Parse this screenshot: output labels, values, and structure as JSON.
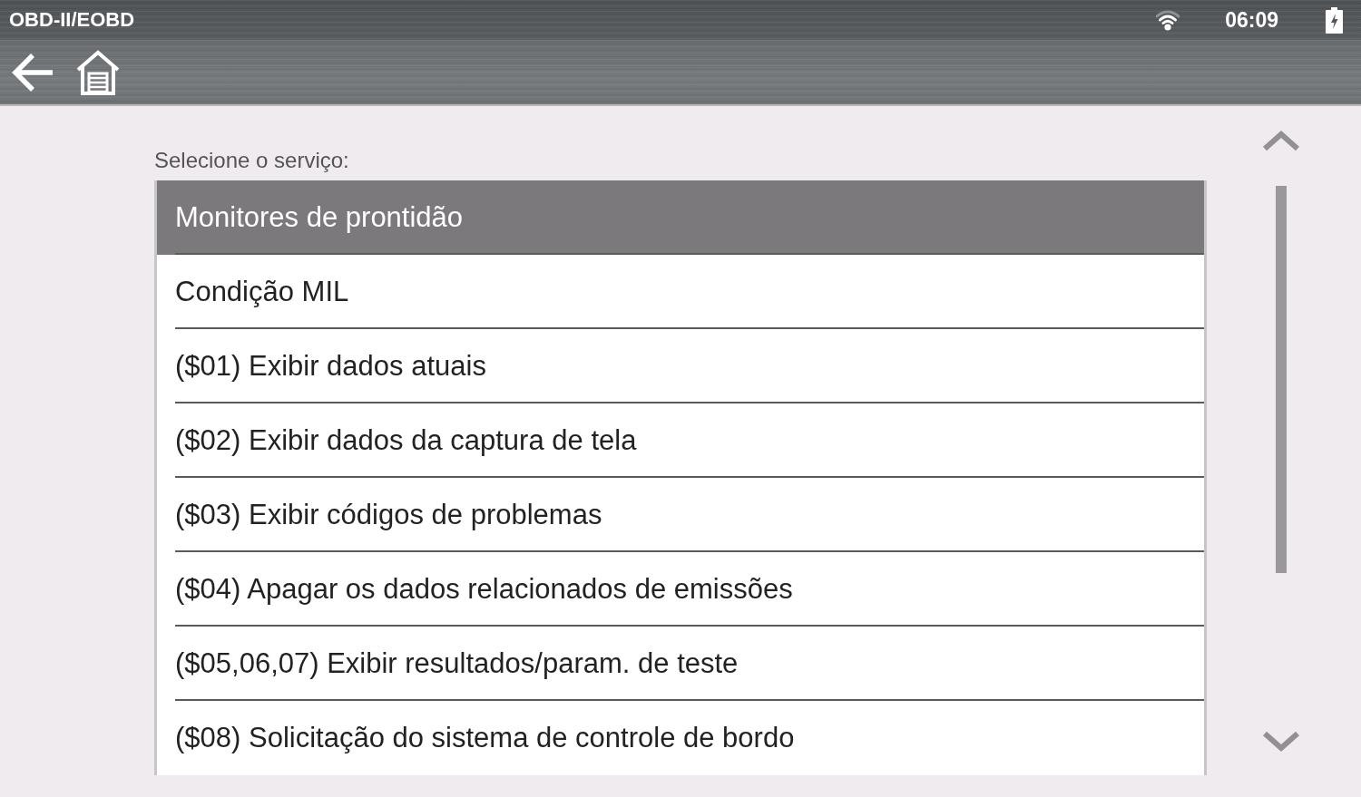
{
  "status_bar": {
    "title": "OBD-II/EOBD",
    "time": "06:09"
  },
  "prompt": "Selecione o serviço:",
  "services": [
    {
      "label": "Monitores de prontidão",
      "selected": true
    },
    {
      "label": "Condição MIL",
      "selected": false
    },
    {
      "label": "($01) Exibir dados atuais",
      "selected": false
    },
    {
      "label": "($02) Exibir dados da captura de tela",
      "selected": false
    },
    {
      "label": "($03) Exibir códigos de problemas",
      "selected": false
    },
    {
      "label": "($04) Apagar os dados relacionados de emissões",
      "selected": false
    },
    {
      "label": "($05,06,07) Exibir resultados/param. de teste",
      "selected": false
    },
    {
      "label": "($08) Solicitação do sistema de controle de bordo",
      "selected": false
    }
  ]
}
